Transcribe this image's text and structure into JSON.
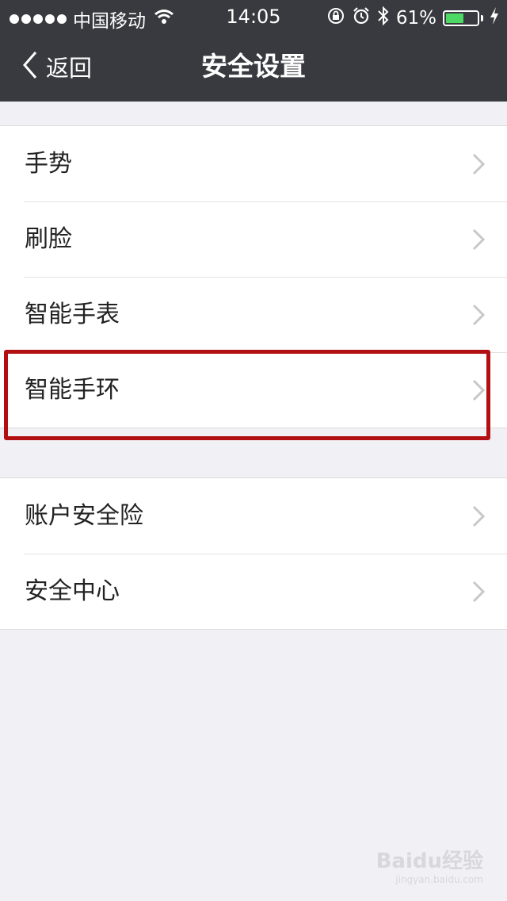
{
  "status_bar": {
    "carrier": "中国移动",
    "time": "14:05",
    "battery_percent": "61%",
    "battery_level": 0.61,
    "icons": [
      "signal-dots-icon",
      "wifi-icon",
      "rotation-lock-icon",
      "alarm-icon",
      "bluetooth-icon",
      "battery-icon",
      "charging-icon"
    ]
  },
  "nav": {
    "back_label": "返回",
    "title": "安全设置"
  },
  "groups": [
    {
      "items": [
        {
          "label": "手势"
        },
        {
          "label": "刷脸"
        },
        {
          "label": "智能手表"
        },
        {
          "label": "智能手环",
          "highlighted": true
        }
      ]
    },
    {
      "items": [
        {
          "label": "账户安全险"
        },
        {
          "label": "安全中心"
        }
      ]
    }
  ],
  "watermark": {
    "text": "Baidu经验",
    "url": "jingyan.baidu.com"
  },
  "colors": {
    "topbar": "#393a3f",
    "background": "#f1f1f5",
    "highlight_border": "#b20f12",
    "battery_fill": "#4cd964"
  }
}
